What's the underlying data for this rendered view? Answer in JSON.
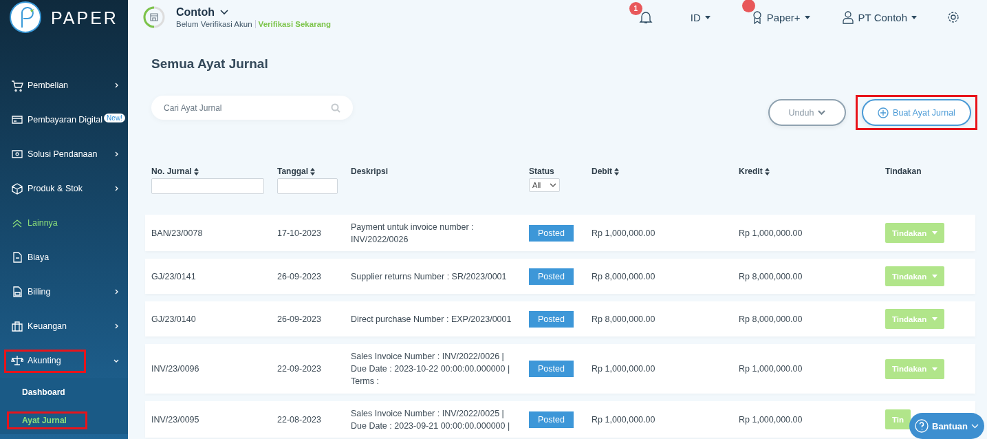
{
  "brand": {
    "name": "PAPER"
  },
  "sidebar": {
    "items": [
      {
        "label": "Pembelian",
        "kind": "submenu",
        "accent": false,
        "highlighted": false
      },
      {
        "label": "Pembayaran Digital",
        "kind": "submenu",
        "accent": false,
        "highlighted": false,
        "badge": "New!"
      },
      {
        "label": "Solusi Pendanaan",
        "kind": "submenu",
        "accent": false,
        "highlighted": false
      },
      {
        "label": "Produk & Stok",
        "kind": "submenu",
        "accent": false,
        "highlighted": false
      },
      {
        "label": "Lainnya",
        "kind": "link",
        "accent": true,
        "highlighted": false
      },
      {
        "label": "Biaya",
        "kind": "link",
        "accent": false,
        "highlighted": false
      },
      {
        "label": "Billing",
        "kind": "submenu",
        "accent": false,
        "highlighted": false
      },
      {
        "label": "Keuangan",
        "kind": "submenu",
        "accent": false,
        "highlighted": false
      },
      {
        "label": "Akunting",
        "kind": "submenu",
        "accent": false,
        "highlighted": true,
        "children": [
          {
            "label": "Dashboard",
            "selected": false,
            "highlighted": false
          },
          {
            "label": "Ayat Jurnal",
            "selected": true,
            "highlighted": true
          }
        ]
      }
    ]
  },
  "header": {
    "company": "Contoh",
    "verification_status": "Belum Verifikasi Akun",
    "verify_link": "Verifikasi Sekarang",
    "notification_count": "1",
    "language": "ID",
    "plan": "Paper+",
    "user": "PT Contoh"
  },
  "page": {
    "title": "Semua Ayat Jurnal",
    "search": {
      "placeholder": "Cari Ayat Jurnal"
    },
    "download_button": "Unduh",
    "create_button": {
      "label": "Buat Ayat Jurnal",
      "highlighted": true
    }
  },
  "table": {
    "columns": [
      {
        "label": "No. Jurnal",
        "sortable": true,
        "kind": "text"
      },
      {
        "label": "Tanggal",
        "sortable": true,
        "kind": "text"
      },
      {
        "label": "Deskripsi",
        "sortable": false,
        "kind": "plain"
      },
      {
        "label": "Status",
        "sortable": false,
        "kind": "select",
        "filter_value": "All"
      },
      {
        "label": "Debit",
        "sortable": true,
        "kind": "plain"
      },
      {
        "label": "Kredit",
        "sortable": true,
        "kind": "plain"
      },
      {
        "label": "Tindakan",
        "sortable": false,
        "kind": "plain"
      }
    ],
    "rows": [
      {
        "number": "BAN/23/0078",
        "date": "17-10-2023",
        "description": [
          "Payment untuk invoice number :",
          "INV/2022/0026"
        ],
        "status": "Posted",
        "debit": "Rp 1,000,000.00",
        "credit": "Rp 1,000,000.00",
        "action": "Tindakan"
      },
      {
        "number": "GJ/23/0141",
        "date": "26-09-2023",
        "description": [
          "Supplier returns Number : SR/2023/0001"
        ],
        "status": "Posted",
        "debit": "Rp 8,000,000.00",
        "credit": "Rp 8,000,000.00",
        "action": "Tindakan"
      },
      {
        "number": "GJ/23/0140",
        "date": "26-09-2023",
        "description": [
          "Direct purchase Number : EXP/2023/0001"
        ],
        "status": "Posted",
        "debit": "Rp 8,000,000.00",
        "credit": "Rp 8,000,000.00",
        "action": "Tindakan"
      },
      {
        "number": "INV/23/0096",
        "date": "22-09-2023",
        "description": [
          "Sales Invoice Number : INV/2022/0026 |",
          "Due Date : 2023-10-22 00:00:00.000000 |",
          "Terms :"
        ],
        "status": "Posted",
        "debit": "Rp 1,000,000.00",
        "credit": "Rp 1,000,000.00",
        "action": "Tindakan"
      },
      {
        "number": "INV/23/0095",
        "date": "22-08-2023",
        "description": [
          "Sales Invoice Number : INV/2022/0025 |",
          "Due Date : 2023-09-21 00:00:00.000000 |"
        ],
        "status": "Posted",
        "debit": "Rp 1,000,000.00",
        "credit": "Rp 1,000,000.00",
        "action": "Tin"
      }
    ]
  },
  "help_button": "Bantuan"
}
